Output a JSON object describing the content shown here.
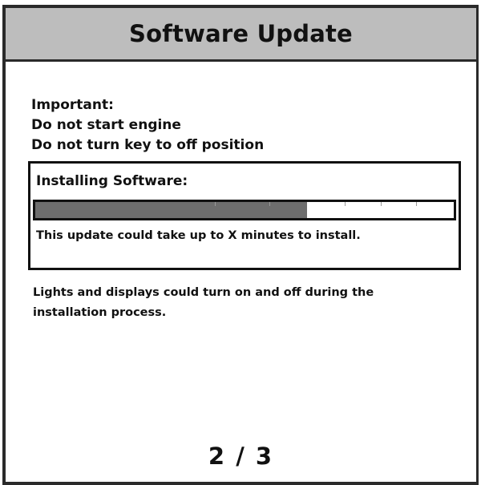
{
  "header": {
    "title": "Software Update"
  },
  "warning": {
    "heading": "Important:",
    "line1": "Do not start engine",
    "line2": "Do not turn key to off position"
  },
  "install": {
    "title": "Installing Software:",
    "progress_fraction": 0.65,
    "note": "This update could take up to X minutes to install."
  },
  "info": {
    "text": "Lights and displays could turn on and off during the installation process."
  },
  "pagination": {
    "text": "2 / 3"
  },
  "colors": {
    "title_bar_bg": "#bdbdbd",
    "progress_fill": "#6e6e6e",
    "border": "#111111"
  }
}
